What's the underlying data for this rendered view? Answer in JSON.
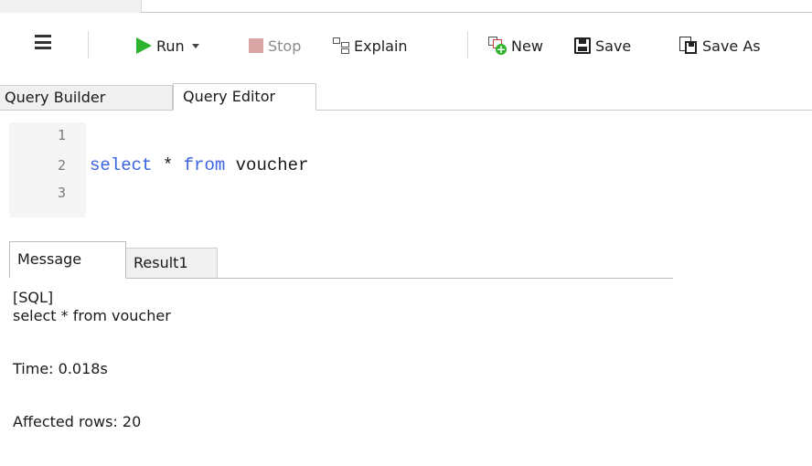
{
  "toolbar": {
    "menu_icon": "hamburger-menu-icon",
    "run": {
      "label": "Run",
      "icon": "play-icon",
      "icon_color": "#2db32d"
    },
    "stop": {
      "label": "Stop",
      "icon": "stop-icon",
      "icon_color": "#d9a4a4"
    },
    "explain": {
      "label": "Explain",
      "icon": "explain-icon"
    },
    "new": {
      "label": "New",
      "icon": "new-query-icon"
    },
    "save": {
      "label": "Save",
      "icon": "save-icon"
    },
    "save_as": {
      "label": "Save As",
      "icon": "save-as-icon"
    }
  },
  "query_tabs": [
    {
      "label": "Query Builder",
      "active": false
    },
    {
      "label": "Query Editor",
      "active": true
    }
  ],
  "editor": {
    "line_numbers": [
      "1",
      "2",
      "3"
    ],
    "code": {
      "keyword_select": "select",
      "star": "*",
      "keyword_from": "from",
      "table": "voucher"
    },
    "keyword_color": "#3a63e0"
  },
  "result_tabs": [
    {
      "label": "Message",
      "active": true
    },
    {
      "label": "Result1",
      "active": false
    }
  ],
  "message": {
    "header": "[SQL]",
    "sql": "select * from voucher",
    "time": "Time: 0.018s",
    "affected": "Affected rows: 20"
  }
}
